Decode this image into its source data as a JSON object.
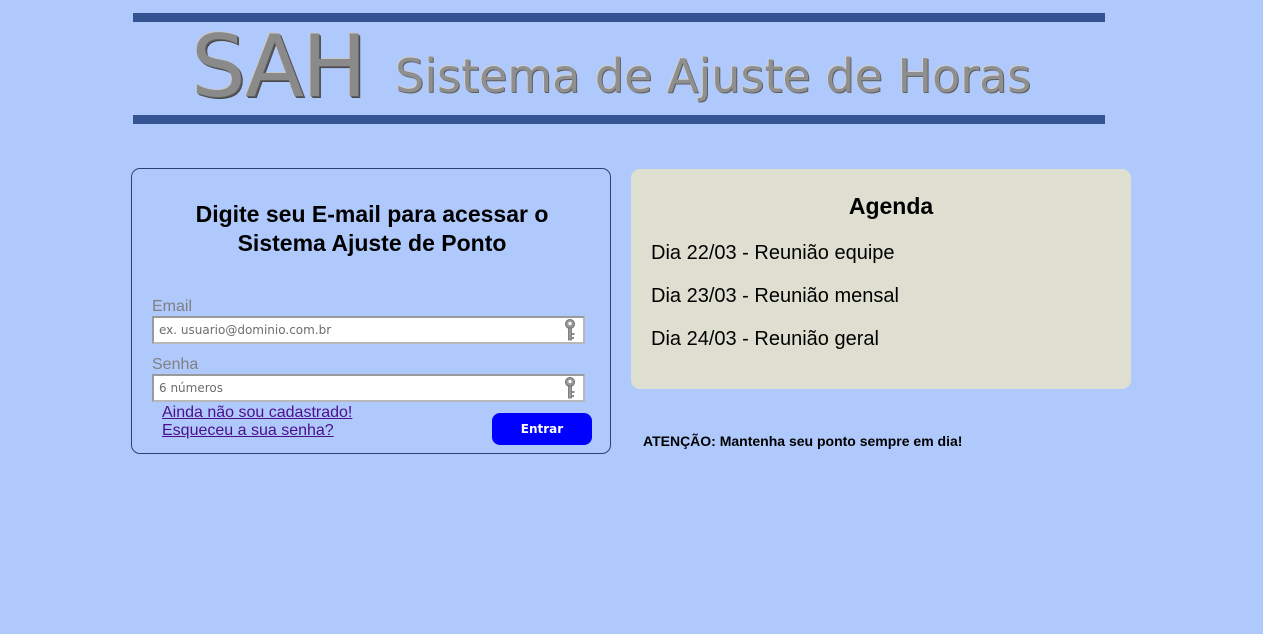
{
  "banner": {
    "logo_text": "SAH",
    "subtitle": "Sistema de Ajuste de Horas"
  },
  "login": {
    "heading_line1": "Digite seu E-mail para acessar o",
    "heading_line2": "Sistema Ajuste de Ponto",
    "email_label": "Email",
    "email_placeholder": "ex. usuario@dominio.com.br",
    "email_value": "",
    "email_icon": "key-icon",
    "password_label": "Senha",
    "password_placeholder": "6 números",
    "password_value": "",
    "password_icon": "key-icon",
    "register_link": "Ainda não sou cadastrado!",
    "forgot_link": "Esqueceu a sua senha?",
    "submit_label": "Entrar"
  },
  "agenda": {
    "title": "Agenda",
    "items": [
      "Dia 22/03 - Reunião equipe",
      "Dia 23/03 - Reunião mensal",
      "Dia 24/03 - Reunião geral"
    ]
  },
  "notice": "ATENÇÃO: Mantenha seu ponto sempre em dia!",
  "colors": {
    "background": "#b0c9fc",
    "banner_bar": "#345392",
    "submit_button": "#0000ff",
    "agenda_panel": "#dfdfd1",
    "link": "#4b0f8c"
  }
}
